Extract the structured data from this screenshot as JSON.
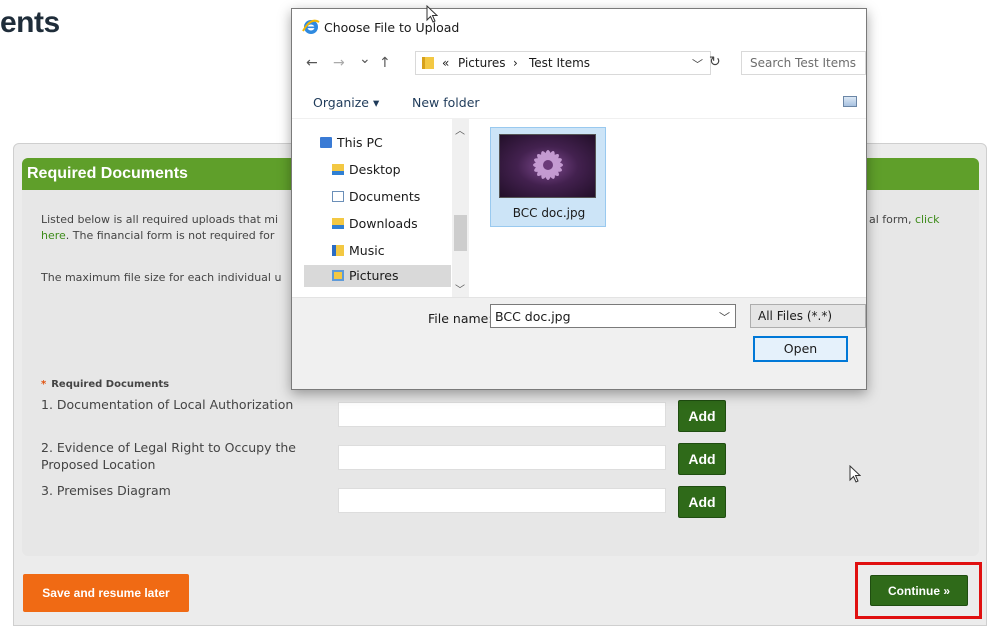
{
  "page": {
    "title": "ents"
  },
  "panel": {
    "header": "Required Documents",
    "intro_line1_start": "Listed below is all required uploads that mi",
    "intro_line1_end": "al form,",
    "intro_link_click": "click",
    "intro_link_here": "here",
    "intro_line2_rest": ". The financial form is not required for",
    "intro_line3": "The maximum file size for each individual u",
    "required_title": "Required Documents",
    "required_star": "*",
    "documents": [
      {
        "label": "1. Documentation of Local Authorization",
        "add": "Add"
      },
      {
        "label": "2. Evidence of Legal Right to Occupy the Proposed Location",
        "add": "Add"
      },
      {
        "label": "3. Premises Diagram",
        "add": "Add"
      }
    ]
  },
  "actions": {
    "save_label": "Save and resume later",
    "continue_label": "Continue »",
    "highlight_color": "#e01010"
  },
  "dialog": {
    "title": "Choose File to Upload",
    "nav": {
      "back": "←",
      "forward": "→",
      "recent": "⌄",
      "up": "↑"
    },
    "address": {
      "overflow": "«",
      "segment1": "Pictures",
      "separator": "›",
      "segment2": "Test Items"
    },
    "search_placeholder": "Search Test Items",
    "toolbar": {
      "organize": "Organize ▾",
      "new_folder": "New folder"
    },
    "tree": [
      {
        "label": "This PC",
        "icon": "pc-icon",
        "color": "#3a7bd5"
      },
      {
        "label": "Desktop",
        "icon": "desktop-folder-icon",
        "color": "#2f7fd3"
      },
      {
        "label": "Documents",
        "icon": "documents-folder-icon",
        "color": "#6b8fb8"
      },
      {
        "label": "Downloads",
        "icon": "downloads-folder-icon",
        "color": "#2f7fd3"
      },
      {
        "label": "Music",
        "icon": "music-folder-icon",
        "color": "#2b6cc4"
      },
      {
        "label": "Pictures",
        "icon": "pictures-folder-icon",
        "color": "#5f9ad8"
      }
    ],
    "file": {
      "name": "BCC doc.jpg"
    },
    "filename_label": "File name:",
    "filename_value": "BCC doc.jpg",
    "filter": "All Files (*.*)",
    "open_label": "Open"
  }
}
